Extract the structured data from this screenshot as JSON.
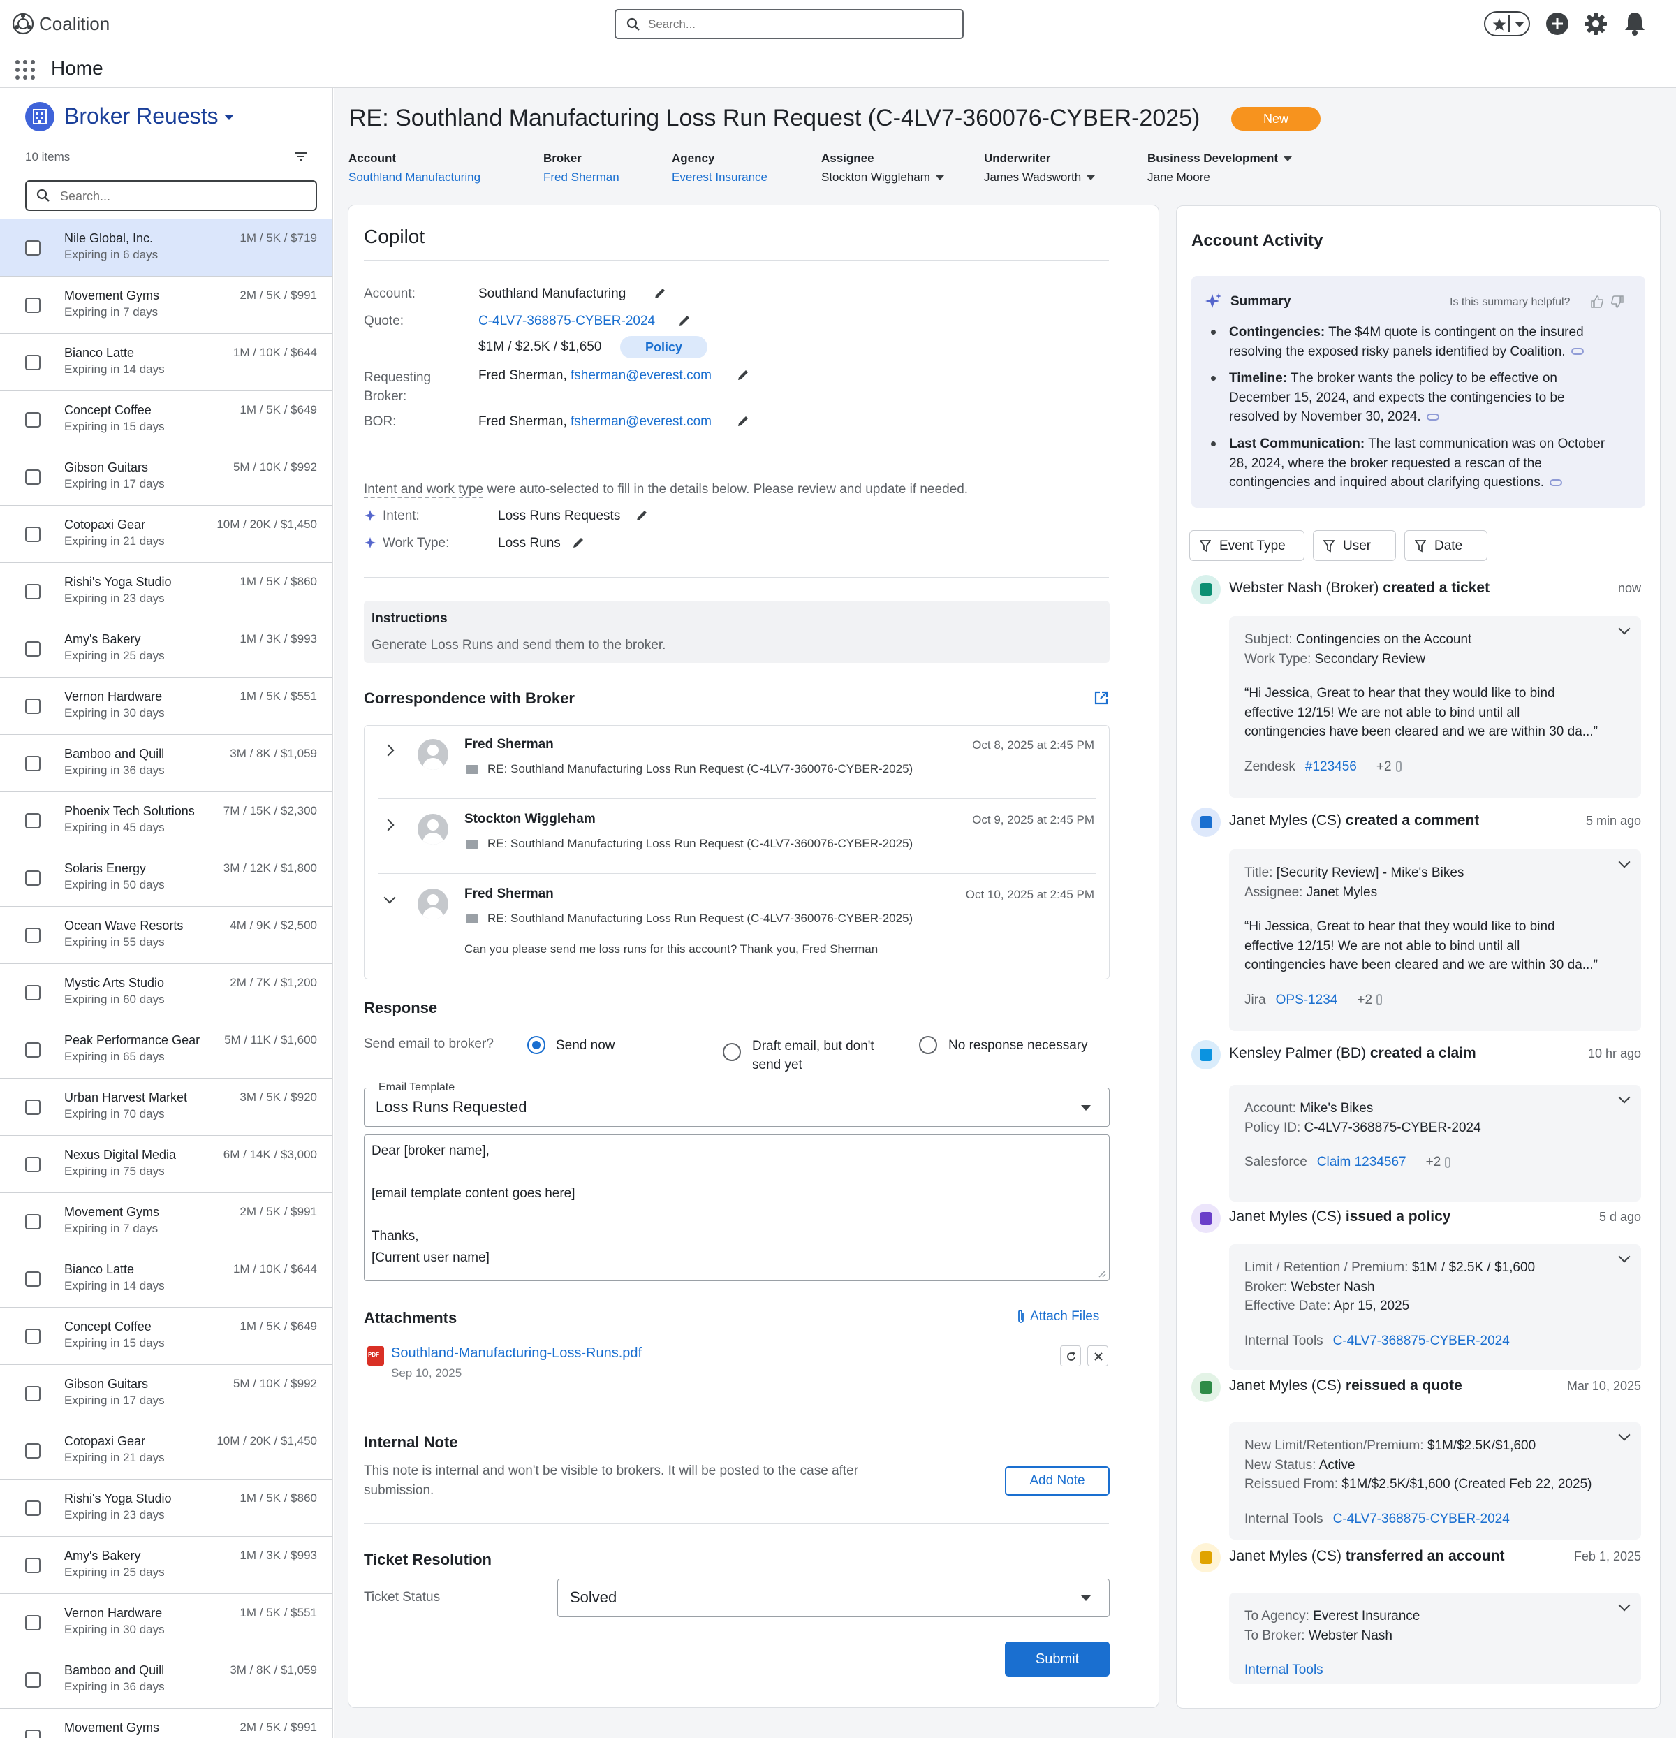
{
  "topbar": {
    "logo_text": "Coalition",
    "search_placeholder": "Search..."
  },
  "homebar": {
    "title": "Home"
  },
  "sidebar": {
    "title": "Broker Reuests",
    "count": "10 items",
    "search_placeholder": "Search...",
    "items": [
      {
        "name": "Nile Global, Inc.",
        "expiry": "Expiring in 6 days",
        "price": "1M / 5K / $719"
      },
      {
        "name": "Movement Gyms",
        "expiry": "Expiring in 7 days",
        "price": "2M / 5K / $991"
      },
      {
        "name": "Bianco Latte",
        "expiry": "Expiring in 14 days",
        "price": "1M / 10K / $644"
      },
      {
        "name": "Concept Coffee",
        "expiry": "Expiring in 15 days",
        "price": "1M / 5K / $649"
      },
      {
        "name": "Gibson Guitars",
        "expiry": "Expiring in 17 days",
        "price": "5M / 10K / $992"
      },
      {
        "name": "Cotopaxi Gear",
        "expiry": "Expiring in 21 days",
        "price": "10M / 20K / $1,450"
      },
      {
        "name": "Rishi's Yoga Studio",
        "expiry": "Expiring in 23 days",
        "price": "1M / 5K / $860"
      },
      {
        "name": "Amy's Bakery",
        "expiry": "Expiring in 25 days",
        "price": "1M / 3K / $993"
      },
      {
        "name": "Vernon Hardware",
        "expiry": "Expiring in 30 days",
        "price": "1M / 5K / $551"
      },
      {
        "name": "Bamboo and Quill",
        "expiry": "Expiring in 36 days",
        "price": "3M / 8K / $1,059"
      },
      {
        "name": "Phoenix Tech Solutions",
        "expiry": "Expiring in 45 days",
        "price": "7M / 15K / $2,300"
      },
      {
        "name": "Solaris Energy",
        "expiry": "Expiring in 50 days",
        "price": "3M / 12K / $1,800"
      },
      {
        "name": "Ocean Wave Resorts",
        "expiry": "Expiring in 55 days",
        "price": "4M / 9K / $2,500"
      },
      {
        "name": "Mystic Arts Studio",
        "expiry": "Expiring in 60 days",
        "price": "2M / 7K / $1,200"
      },
      {
        "name": "Peak Performance Gear",
        "expiry": "Expiring in 65 days",
        "price": "5M / 11K / $1,600"
      },
      {
        "name": "Urban Harvest Market",
        "expiry": "Expiring in 70 days",
        "price": "3M / 5K / $920"
      },
      {
        "name": "Nexus Digital Media",
        "expiry": "Expiring in 75 days",
        "price": "6M / 14K / $3,000"
      },
      {
        "name": "Movement Gyms",
        "expiry": "Expiring in 7 days",
        "price": "2M / 5K / $991"
      },
      {
        "name": "Bianco Latte",
        "expiry": "Expiring in 14 days",
        "price": "1M / 10K / $644"
      },
      {
        "name": "Concept Coffee",
        "expiry": "Expiring in 15 days",
        "price": "1M / 5K / $649"
      },
      {
        "name": "Gibson Guitars",
        "expiry": "Expiring in 17 days",
        "price": "5M / 10K / $992"
      },
      {
        "name": "Cotopaxi Gear",
        "expiry": "Expiring in 21 days",
        "price": "10M / 20K / $1,450"
      },
      {
        "name": "Rishi's Yoga Studio",
        "expiry": "Expiring in 23 days",
        "price": "1M / 5K / $860"
      },
      {
        "name": "Amy's Bakery",
        "expiry": "Expiring in 25 days",
        "price": "1M / 3K / $993"
      },
      {
        "name": "Vernon Hardware",
        "expiry": "Expiring in 30 days",
        "price": "1M / 5K / $551"
      },
      {
        "name": "Bamboo and Quill",
        "expiry": "Expiring in 36 days",
        "price": "3M / 8K / $1,059"
      },
      {
        "name": "Movement Gyms",
        "expiry": "",
        "price": "2M / 5K / $991"
      }
    ]
  },
  "header": {
    "title": "RE: Southland Manufacturing Loss Run Request (C-4LV7-360076-CYBER-2025)",
    "status": "New",
    "fields": {
      "account_label": "Account",
      "account_value": "Southland Manufacturing",
      "broker_label": "Broker",
      "broker_value": "Fred Sherman",
      "agency_label": "Agency",
      "agency_value": "Everest Insurance",
      "assignee_label": "Assignee",
      "assignee_value": "Stockton Wiggleham",
      "underwriter_label": "Underwriter",
      "underwriter_value": "James Wadsworth",
      "bizdev_label": "Business Development",
      "bizdev_value": "Jane Moore"
    }
  },
  "copilot": {
    "title": "Copilot",
    "account_label": "Account:",
    "account_value": "Southland Manufacturing",
    "quote_label": "Quote:",
    "quote_value": "C-4LV7-368875-CYBER-2024",
    "quote_terms": "$1M / $2.5K / $1,650",
    "policy_badge": "Policy",
    "req_broker_label_1": "Requesting",
    "req_broker_label_2": "Broker:",
    "req_broker_name": "Fred Sherman,",
    "req_broker_email": "fsherman@everest.com",
    "bor_label": "BOR:",
    "bor_name": "Fred Sherman,",
    "bor_email": "fsherman@everest.com",
    "auto_note_1": "Intent and work type",
    "auto_note_2": " were auto-selected to fill in the details below. Please review and update if needed.",
    "intent_label": "Intent:",
    "intent_value": "Loss Runs Requests",
    "worktype_label": "Work Type:",
    "worktype_value": "Loss Runs",
    "instructions_title": "Instructions",
    "instructions_text": "Generate Loss Runs and send them to the broker.",
    "correspondence_title": "Correspondence with Broker",
    "messages": [
      {
        "sender": "Fred Sherman",
        "date": "Oct 8, 2025 at 2:45 PM",
        "subject": "RE: Southland Manufacturing Loss Run Request (C-4LV7-360076-CYBER-2025)",
        "body": ""
      },
      {
        "sender": "Stockton Wiggleham",
        "date": "Oct 9, 2025 at 2:45 PM",
        "subject": "RE: Southland Manufacturing Loss Run Request (C-4LV7-360076-CYBER-2025)",
        "body": ""
      },
      {
        "sender": "Fred Sherman",
        "date": "Oct 10, 2025 at 2:45 PM",
        "subject": "RE: Southland Manufacturing Loss Run Request (C-4LV7-360076-CYBER-2025)",
        "body": "Can you please send me loss runs for this account? Thank you, Fred Sherman"
      }
    ],
    "response_title": "Response",
    "send_email_label": "Send email to broker?",
    "opt_send_now": "Send now",
    "opt_draft_1": "Draft email, but don't",
    "opt_draft_2": "send yet",
    "opt_none": "No response necessary",
    "template_label": "Email Template",
    "template_value": "Loss Runs Requested",
    "email_body": [
      "Dear [broker name],",
      "",
      "[email template content goes here]",
      "",
      "Thanks,",
      "[Current user name]"
    ],
    "attachments_title": "Attachments",
    "attach_files": "Attach Files",
    "file_name": "Southland-Manufacturing-Loss-Runs.pdf",
    "file_date": "Sep 10, 2025",
    "file_badge": "PDF",
    "internal_note_title": "Internal Note",
    "internal_note_text_1": "This note is internal and won't be visible to brokers. It will be posted to the case after",
    "internal_note_text_2": "submission.",
    "add_note": "Add Note",
    "ticket_title": "Ticket Resolution",
    "ticket_status_label": "Ticket Status",
    "ticket_status_value": "Solved",
    "submit": "Submit"
  },
  "activity": {
    "title": "Account Activity",
    "summary_title": "Summary",
    "helpful_q": "Is this summary helpful?",
    "bullets": [
      {
        "bold": "Contingencies:",
        "l1": " The $4M quote is contingent on the insured",
        "l2": "resolving the exposed risky panels identified by Coalition."
      },
      {
        "bold": "Timeline:",
        "l1": " The broker wants the policy to be effective on",
        "l2": "December 15, 2024, and expects the contingencies to be",
        "l3": "resolved by November 30, 2024."
      },
      {
        "bold": "Last Communication:",
        "l1": " The last communication was on October",
        "l2": "28, 2024, where the broker requested a rescan of the",
        "l3": "contingencies and inquired about clarifying questions."
      }
    ],
    "filters": [
      "Event Type",
      "User",
      "Date"
    ],
    "events": [
      {
        "actor": "Webster Nash (Broker)",
        "action": "created a ticket",
        "time": "now",
        "k1": "Subject:",
        "v1": " Contingencies on the Account",
        "k2": "Work Type:",
        "v2": " Secondary Review",
        "q1": "“Hi Jessica, Great to hear that they would like to bind",
        "q2": "effective 12/15! We are not able to bind until all",
        "q3": "contingencies have been cleared and we are within 30 da...”",
        "src": "Zendesk",
        "ref": "#123456",
        "extra": "+2"
      },
      {
        "actor": "Janet Myles (CS)",
        "action": "created a comment",
        "time": "5 min ago",
        "k1": "Title:",
        "v1": " [Security Review] - Mike's Bikes",
        "k2": "Assignee:",
        "v2": " Janet Myles",
        "q1": "“Hi Jessica, Great to hear that they would like to bind",
        "q2": "effective 12/15! We are not able to bind until all",
        "q3": "contingencies have been cleared and we are within 30 da...”",
        "src": "Jira",
        "ref": "OPS-1234",
        "extra": "+2"
      },
      {
        "actor": "Kensley Palmer (BD)",
        "action": "created a claim",
        "time": "10 hr ago",
        "k1": "Account:",
        "v1": " Mike's Bikes",
        "k2": "Policy ID:",
        "v2": " C-4LV7-368875-CYBER-2024",
        "src": "Salesforce",
        "ref": "Claim 1234567",
        "extra": "+2"
      },
      {
        "actor": "Janet Myles (CS)",
        "action": "issued a policy",
        "time": "5 d ago",
        "k1": "Limit / Retention / Premium:",
        "v1": " $1M / $2.5K / $1,600",
        "k2": "Broker:",
        "v2": " Webster Nash",
        "k3": "Effective Date:",
        "v3": " Apr 15, 2025",
        "src": "Internal Tools",
        "ref": "C-4LV7-368875-CYBER-2024"
      },
      {
        "actor": "Janet Myles (CS)",
        "action": "reissued a quote",
        "time": "Mar 10, 2025",
        "k1": "New Limit/Retention/Premium:",
        "v1": " $1M/$2.5K/$1,600",
        "k2": "New Status:",
        "v2": " Active",
        "k3": "Reissued From:",
        "v3": " $1M/$2.5K/$1,600 (Created Feb 22, 2025)",
        "src": "Internal Tools",
        "ref": "C-4LV7-368875-CYBER-2024"
      },
      {
        "actor": "Janet Myles (CS)",
        "action": "transferred an account",
        "time": "Feb 1, 2025",
        "k1": "To Agency:",
        "v1": " Everest Insurance",
        "k2": "To Broker:",
        "v2": " Webster Nash",
        "ref": "Internal Tools"
      }
    ]
  },
  "colors": {
    "accent": "#1a6fd0",
    "badge_new": "#f7931e",
    "selected_row": "#dbe6fb",
    "summary_bg": "#eef0f8"
  }
}
